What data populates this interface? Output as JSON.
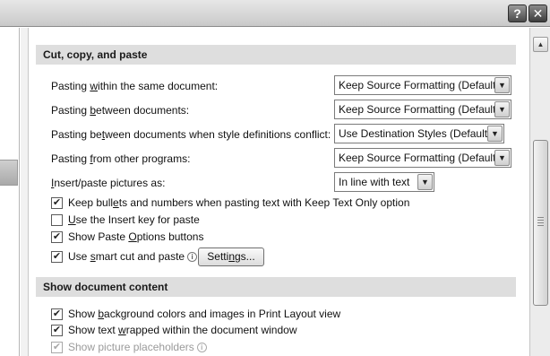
{
  "window": {
    "help_label": "?",
    "close_label": "✕"
  },
  "sections": {
    "cut_copy_paste": {
      "title": "Cut, copy, and paste",
      "options": [
        {
          "pre": "Pasting ",
          "ul": "w",
          "post": "ithin the same document:",
          "value": "Keep Source Formatting (Default)"
        },
        {
          "pre": "Pasting ",
          "ul": "b",
          "post": "etween documents:",
          "value": "Keep Source Formatting (Default)"
        },
        {
          "pre": "Pasting be",
          "ul": "t",
          "post": "ween documents when style definitions conflict:",
          "value": "Use Destination Styles (Default)"
        },
        {
          "pre": "Pasting ",
          "ul": "f",
          "post": "rom other programs:",
          "value": "Keep Source Formatting (Default)"
        },
        {
          "pre": "",
          "ul": "I",
          "post": "nsert/paste pictures as:",
          "value": "In line with text"
        }
      ],
      "checks": [
        {
          "pre": "Keep bull",
          "ul": "e",
          "post": "ts and numbers when pasting text with Keep Text Only option",
          "checked": true
        },
        {
          "pre": "",
          "ul": "U",
          "post": "se the Insert key for paste",
          "checked": false
        },
        {
          "pre": "Show Paste ",
          "ul": "O",
          "post": "ptions buttons",
          "checked": true
        },
        {
          "pre": "Use ",
          "ul": "s",
          "post": "mart cut and paste",
          "checked": true
        }
      ],
      "settings_button": {
        "pre": "Setti",
        "ul": "n",
        "post": "gs..."
      }
    },
    "show_document_content": {
      "title": "Show document content",
      "checks": [
        {
          "pre": "Show ",
          "ul": "b",
          "post": "ackground colors and images in Print Layout view",
          "checked": true
        },
        {
          "pre": "Show text ",
          "ul": "w",
          "post": "rapped within the document window",
          "checked": true
        },
        {
          "pre": "Show picture placeholders",
          "ul": "",
          "post": "",
          "checked": true,
          "disabled": true
        }
      ]
    }
  },
  "icons": {
    "check": "✔",
    "dropdown": "▼",
    "scroll_up": "▲",
    "info": "i"
  }
}
